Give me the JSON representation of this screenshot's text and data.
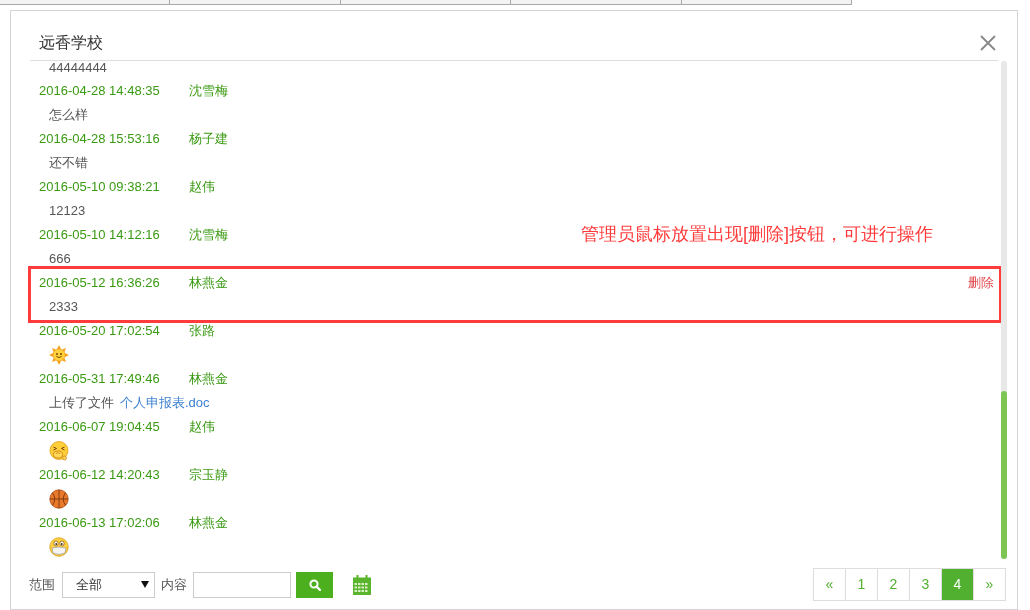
{
  "dialog": {
    "title": "远香学校"
  },
  "messages": [
    {
      "highlighted": false,
      "body": {
        "kind": "text",
        "text": "44444444"
      }
    },
    {
      "time": "2016-04-28 14:48:35",
      "author": "沈雪梅",
      "highlighted": false,
      "body": {
        "kind": "text",
        "text": "怎么样"
      }
    },
    {
      "time": "2016-04-28 15:53:16",
      "author": "杨子建",
      "highlighted": false,
      "body": {
        "kind": "text",
        "text": "还不错"
      }
    },
    {
      "time": "2016-05-10 09:38:21",
      "author": "赵伟",
      "highlighted": false,
      "body": {
        "kind": "text",
        "text": "12123"
      }
    },
    {
      "time": "2016-05-10 14:12:16",
      "author": "沈雪梅",
      "highlighted": false,
      "body": {
        "kind": "text",
        "text": "666"
      }
    },
    {
      "time": "2016-05-12 16:36:26",
      "author": "林燕金",
      "highlighted": true,
      "delete_label": "删除",
      "body": {
        "kind": "text",
        "text": "2333"
      }
    },
    {
      "time": "2016-05-20 17:02:54",
      "author": "张路",
      "highlighted": false,
      "body": {
        "kind": "sun"
      }
    },
    {
      "time": "2016-05-31 17:49:46",
      "author": "林燕金",
      "highlighted": false,
      "body": {
        "kind": "file",
        "text": "上传了文件",
        "file_name": "个人申报表.doc"
      }
    },
    {
      "time": "2016-06-07 19:04:45",
      "author": "赵伟",
      "highlighted": false,
      "body": {
        "kind": "pondering"
      }
    },
    {
      "time": "2016-06-12 14:20:43",
      "author": "宗玉静",
      "highlighted": false,
      "body": {
        "kind": "basketball"
      }
    },
    {
      "time": "2016-06-13 17:02:06",
      "author": "林燕金",
      "highlighted": false,
      "body": {
        "kind": "masked"
      }
    }
  ],
  "annotation": "管理员鼠标放置出现[删除]按钮，可进行操作",
  "filter": {
    "range_label": "范围",
    "range_value": "全部",
    "content_label": "内容"
  },
  "pagination": {
    "prev": "«",
    "pages": [
      {
        "label": "1",
        "selected": false
      },
      {
        "label": "2",
        "selected": false
      },
      {
        "label": "3",
        "selected": false
      },
      {
        "label": "4",
        "selected": true
      }
    ],
    "next": "»"
  }
}
